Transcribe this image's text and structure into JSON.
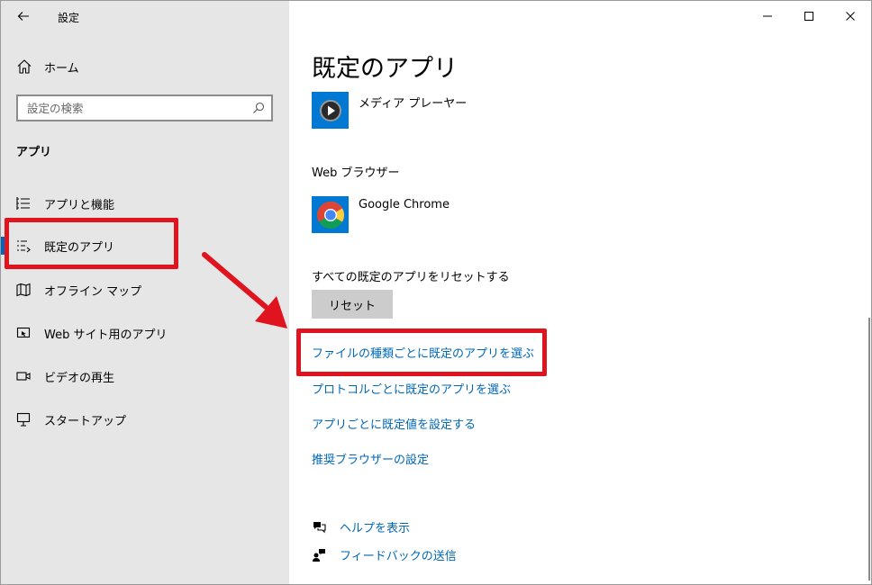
{
  "window": {
    "title": "設定",
    "colors": {
      "sidebar_bg": "#e6e6e6",
      "accent": "#0067c0",
      "link": "#0067b8",
      "annotation_red": "#e0141e"
    }
  },
  "sidebar": {
    "home_label": "ホーム",
    "search": {
      "placeholder": "設定の検索",
      "value": ""
    },
    "section_title": "アプリ",
    "items": [
      {
        "label": "アプリと機能",
        "icon": "list-icon",
        "selected": false
      },
      {
        "label": "既定のアプリ",
        "icon": "default-apps-icon",
        "selected": true
      },
      {
        "label": "オフライン マップ",
        "icon": "map-icon",
        "selected": false
      },
      {
        "label": "Web サイト用のアプリ",
        "icon": "web-app-icon",
        "selected": false
      },
      {
        "label": "ビデオの再生",
        "icon": "video-icon",
        "selected": false
      },
      {
        "label": "スタートアップ",
        "icon": "startup-icon",
        "selected": false
      }
    ]
  },
  "main": {
    "title": "既定のアプリ",
    "media_player": {
      "name": "メディア プレーヤー",
      "icon": "media-player-icon"
    },
    "web_browser": {
      "label": "Web ブラウザー",
      "name": "Google Chrome",
      "icon": "chrome-icon"
    },
    "reset": {
      "label": "すべての既定のアプリをリセットする",
      "button": "リセット"
    },
    "links": [
      "ファイルの種類ごとに既定のアプリを選ぶ",
      "プロトコルごとに既定のアプリを選ぶ",
      "アプリごとに既定値を設定する",
      "推奨ブラウザーの設定"
    ],
    "footer": [
      {
        "label": "ヘルプを表示",
        "icon": "help-icon"
      },
      {
        "label": "フィードバックの送信",
        "icon": "feedback-icon"
      }
    ]
  }
}
